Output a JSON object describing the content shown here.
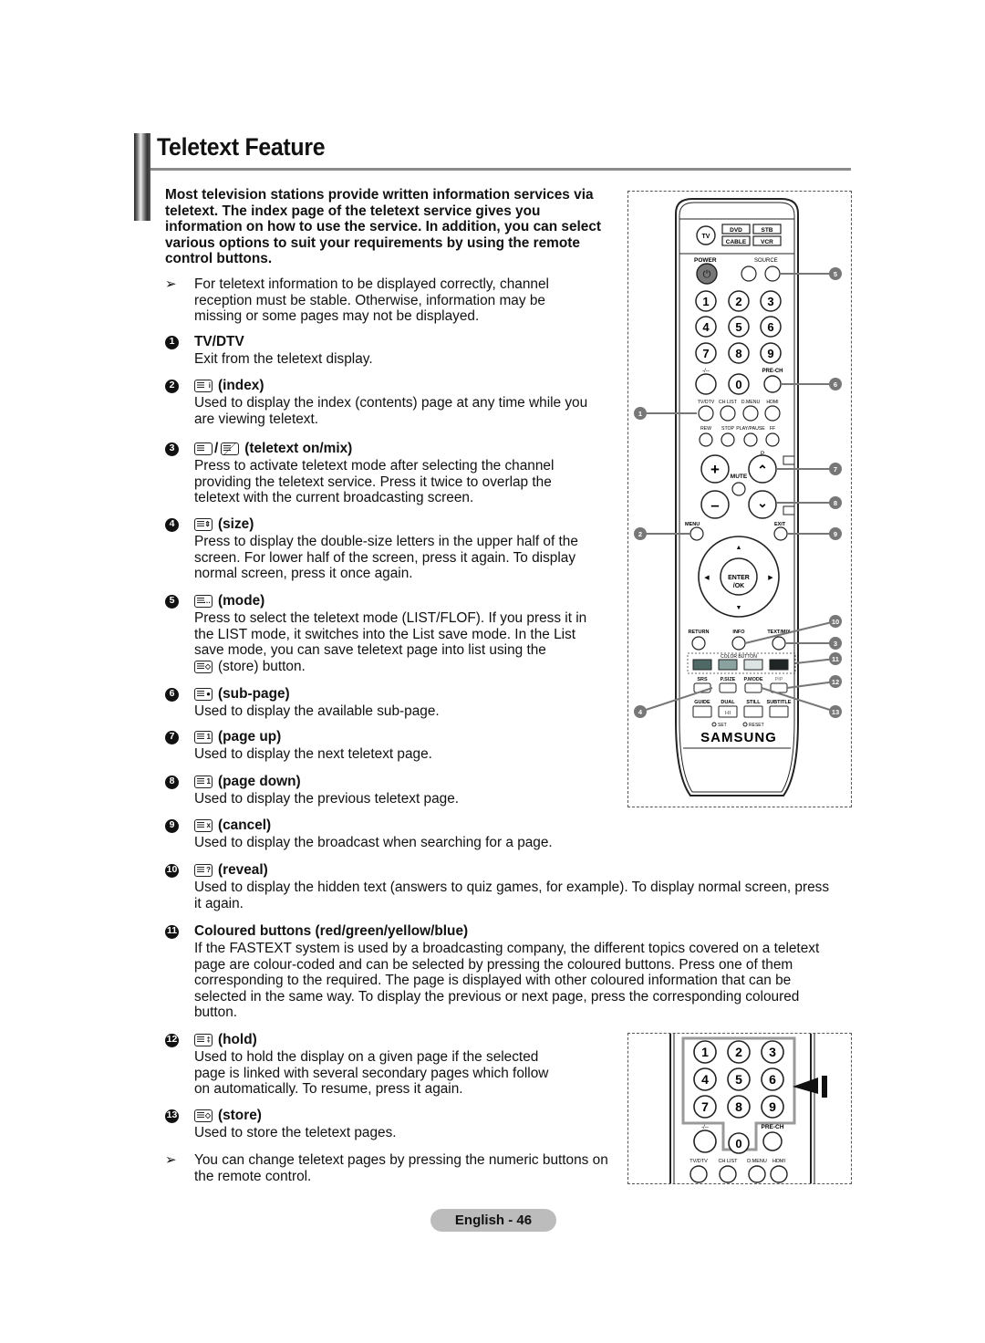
{
  "page": {
    "title": "Teletext Feature",
    "footer": "English - 46"
  },
  "intro": "Most television stations provide written information services via teletext. The index page of the teletext service gives you information on how to use the service. In addition, you can select various options to suit your requirements by using the remote control buttons.",
  "notes": [
    "For teletext information to be displayed correctly, channel reception must be stable. Otherwise, information may be missing or some pages may not be displayed.",
    "You can change teletext pages by pressing the numeric buttons on the remote control."
  ],
  "items": [
    {
      "num": "1",
      "icon": "none",
      "glyph": "",
      "label": "TV/DTV",
      "desc": "Exit from the teletext display."
    },
    {
      "num": "2",
      "icon": "teletext-index-icon",
      "glyph": "i",
      "label": "(index)",
      "desc": "Used to display the index (contents) page at any time while you are viewing teletext."
    },
    {
      "num": "3",
      "icon": "teletext-on-mix-icon",
      "glyph": "",
      "label": "(teletext on/mix)",
      "desc": "Press to activate teletext mode after selecting the channel providing the teletext service. Press it twice to overlap the teletext with the current broadcasting screen."
    },
    {
      "num": "4",
      "icon": "teletext-size-icon",
      "glyph": "⇕",
      "label": "(size)",
      "desc": "Press to display the double-size letters in the upper half of the screen. For lower half of the screen, press it again. To display normal screen, press it once again."
    },
    {
      "num": "5",
      "icon": "teletext-mode-icon",
      "glyph": "…",
      "label": "(mode)",
      "desc": "Press to select the teletext mode (LIST/FLOF). If you press it in the LIST mode, it switches into the List save mode. In the List save mode, you can save teletext page into list using the",
      "desc_tail": "(store) button."
    },
    {
      "num": "6",
      "icon": "teletext-sub-page-icon",
      "glyph": "●",
      "label": "(sub-page)",
      "desc": "Used to display the available sub-page."
    },
    {
      "num": "7",
      "icon": "teletext-page-up-icon",
      "glyph": "1",
      "label": "(page up)",
      "desc": "Used to display the next teletext page."
    },
    {
      "num": "8",
      "icon": "teletext-page-down-icon",
      "glyph": "1",
      "label": "(page down)",
      "desc": "Used to display the previous teletext page."
    },
    {
      "num": "9",
      "icon": "teletext-cancel-icon",
      "glyph": "x",
      "label": "(cancel)",
      "desc": "Used to display the broadcast when searching for a page."
    },
    {
      "num": "10",
      "icon": "teletext-reveal-icon",
      "glyph": "?",
      "label": "(reveal)",
      "desc": "Used to display the hidden text (answers to quiz games, for example). To display normal screen, press it again."
    },
    {
      "num": "11",
      "icon": "none",
      "glyph": "",
      "label": "Coloured buttons (red/green/yellow/blue)",
      "desc": "If the FASTEXT system is used by a broadcasting company, the different topics covered on a teletext page are colour-coded and can be selected by pressing the coloured buttons. Press one of them corresponding to the required. The page is displayed with other coloured information that can be selected in the same way. To display the previous or next page, press the corresponding coloured button."
    },
    {
      "num": "12",
      "icon": "teletext-hold-icon",
      "glyph": "‡",
      "label": "(hold)",
      "desc": "Used to hold the display on a given page if the selected page is linked with several secondary pages which follow on automatically. To resume, press it again."
    },
    {
      "num": "13",
      "icon": "teletext-store-icon",
      "glyph": "◇",
      "label": "(store)",
      "desc": "Used to store the teletext pages."
    }
  ],
  "remote": {
    "brand": "SAMSUNG",
    "mode_buttons": [
      "TV",
      "DVD",
      "STB",
      "CABLE",
      "VCR"
    ],
    "power_label": "POWER",
    "source_label": "SOURCE",
    "digits": [
      "1",
      "2",
      "3",
      "4",
      "5",
      "6",
      "7",
      "8",
      "9",
      "0"
    ],
    "dash_label": "-/--",
    "prech_label": "PRE-CH",
    "row_labels_1": [
      "TV/DTV",
      "CH LIST",
      "D.MENU",
      "HDMI"
    ],
    "row_labels_2": [
      "REW",
      "STOP",
      "PLAY/PAUSE",
      "FF"
    ],
    "p_label": "P",
    "mute_label": "MUTE",
    "menu_label": "MENU",
    "exit_label": "EXIT",
    "enter_label": [
      "ENTER",
      "/OK"
    ],
    "row_labels_3": [
      "RETURN",
      "INFO",
      "TEXT/MIX"
    ],
    "color_button_label": "COLOR BUTTON",
    "color_buttons": [
      "#4f6a66",
      "#8aa3a0",
      "#dde5e4",
      "#1e2524"
    ],
    "row_labels_4": [
      "SRS",
      "P.SIZE",
      "P.MODE",
      "PIP"
    ],
    "row_labels_5": [
      "GUIDE",
      "DUAL",
      "STILL",
      "SUBTITLE"
    ],
    "dual_glyph": "I-II",
    "set_label": "SET",
    "reset_label": "RESET",
    "callouts": [
      "1",
      "2",
      "3",
      "4",
      "5",
      "6",
      "7",
      "8",
      "9",
      "10",
      "11",
      "12",
      "13"
    ]
  },
  "remote_detail": {
    "digits": [
      "1",
      "2",
      "3",
      "4",
      "5",
      "6",
      "7",
      "8",
      "9",
      "0"
    ],
    "dash_label": "-/--",
    "prech_label": "PRE-CH",
    "row_labels": [
      "TV/DTV",
      "CH LIST",
      "D.MENU",
      "HDMI"
    ]
  }
}
